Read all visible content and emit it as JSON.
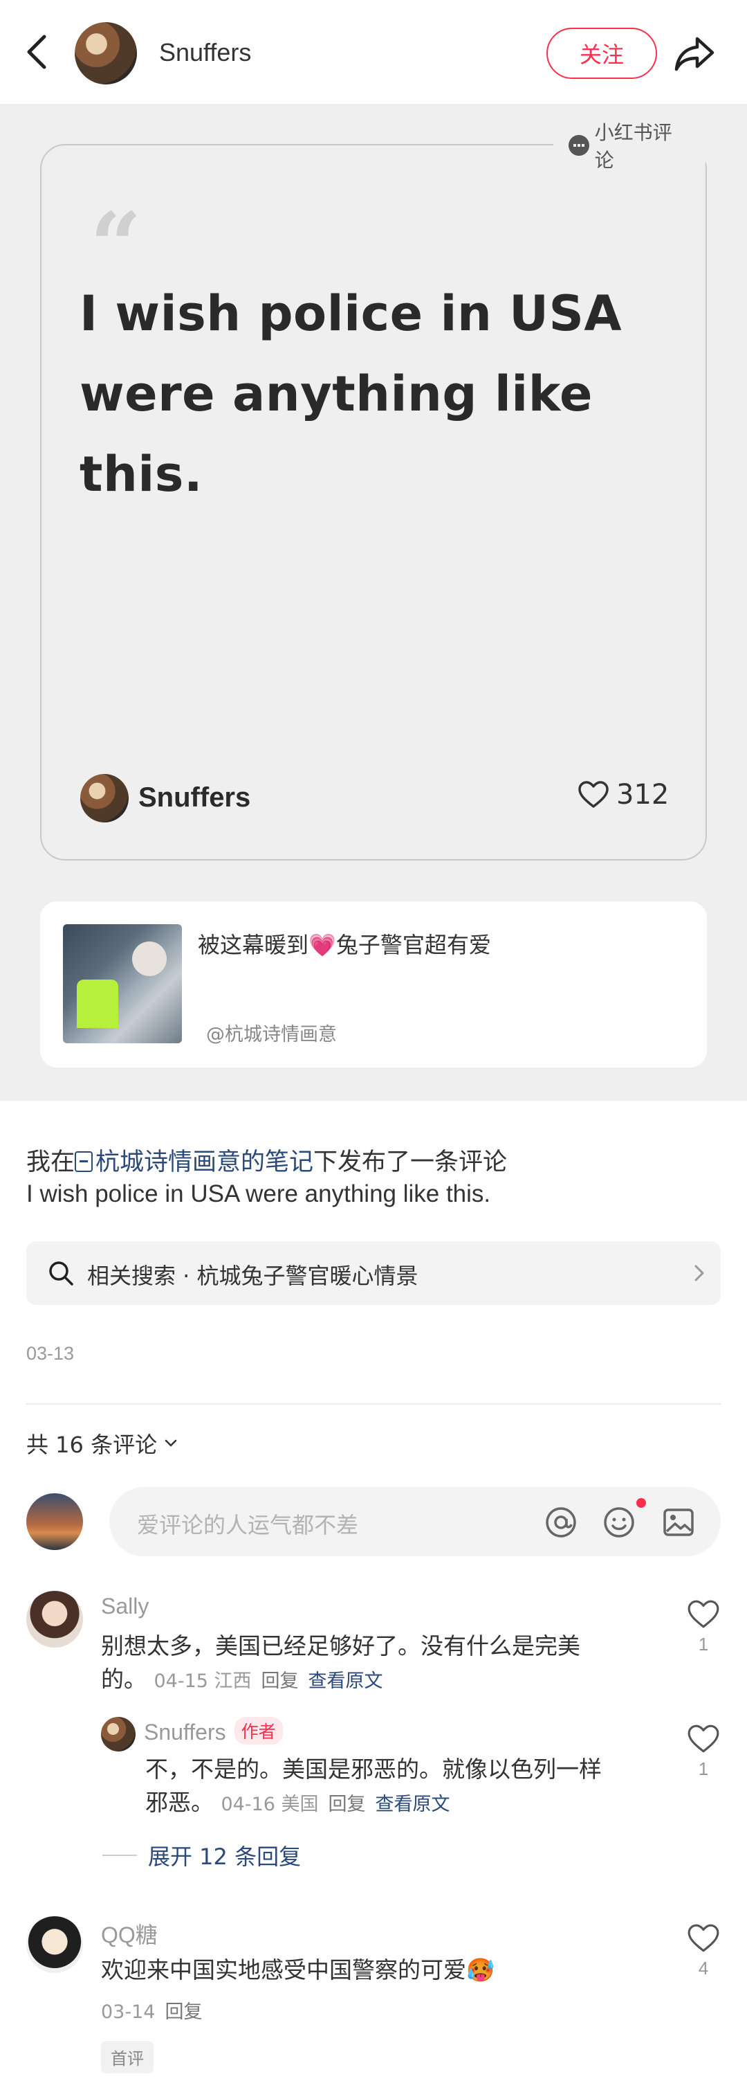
{
  "header": {
    "username": "Snuffers",
    "follow_label": "关注"
  },
  "quote_card": {
    "badge": "小红书评论",
    "quote": "I wish police in USA were anything like this.",
    "author": "Snuffers",
    "likes": "312"
  },
  "linked_note": {
    "title": "被这幕暖到💗兔子警官超有爱",
    "author": "@杭城诗情画意"
  },
  "post": {
    "prefix": "我在",
    "note_link": "杭城诗情画意的笔记",
    "suffix": "下发布了一条评论",
    "body": "I wish police in USA were anything like this.",
    "related_search": "相关搜索 · 杭城兔子警官暖心情景",
    "date": "03-13"
  },
  "comments_section": {
    "count_label": "共 16 条评论",
    "input_placeholder": "爱评论的人运气都不差"
  },
  "comments": [
    {
      "name": "Sally",
      "text_line1": "别想太多，美国已经足够好了。没有什么是完美",
      "text_line2": "的。",
      "meta": "04-15 江西",
      "reply": "回复",
      "view_original": "查看原文",
      "likes": "1"
    },
    {
      "name": "Snuffers",
      "tag": "作者",
      "text_line1": "不，不是的。美国是邪恶的。就像以色列一样",
      "text_line2": "邪恶。",
      "meta": "04-16 美国",
      "reply": "回复",
      "view_original": "查看原文",
      "likes": "1"
    },
    {
      "name": "QQ糖",
      "text_line1": "欢迎来中国实地感受中国警察的可爱🥵",
      "meta": "03-14",
      "reply": "回复",
      "tag": "首评",
      "likes": "4"
    }
  ],
  "expand_replies": "展开 12 条回复",
  "colors": {
    "accent": "#ff2e4d",
    "link": "#2b4a7a",
    "hero_bg": "#efefef"
  }
}
